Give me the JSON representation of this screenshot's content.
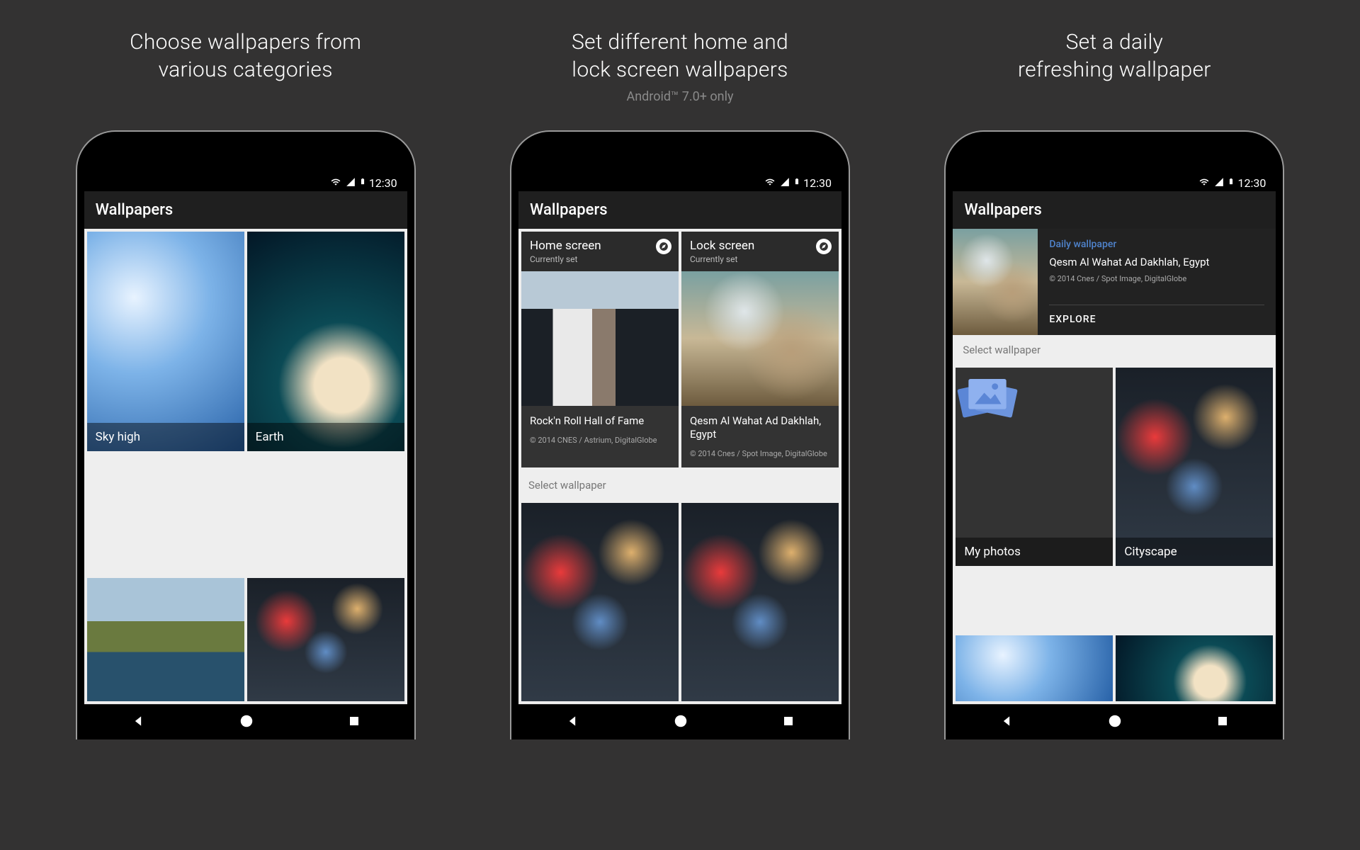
{
  "status_time": "12:30",
  "app_title": "Wallpapers",
  "select_wallpaper": "Select wallpaper",
  "panels": [
    {
      "headline": "Choose wallpapers from\nvarious categories",
      "subhead": "",
      "categories": [
        {
          "label": "Sky high"
        },
        {
          "label": "Earth"
        },
        {
          "label": ""
        },
        {
          "label": ""
        }
      ]
    },
    {
      "headline": "Set different home and\nlock screen wallpapers",
      "subhead": "Android™ 7.0+ only",
      "cards": [
        {
          "title": "Home screen",
          "sub": "Currently set",
          "name": "Rock'n Roll Hall of Fame",
          "attribution": "© 2014 CNES / Astrium, DigitalGlobe"
        },
        {
          "title": "Lock screen",
          "sub": "Currently set",
          "name": "Qesm Al Wahat Ad Dakhlah, Egypt",
          "attribution": "© 2014 Cnes / Spot Image, DigitalGlobe"
        }
      ]
    },
    {
      "headline": "Set a daily\nrefreshing wallpaper",
      "subhead": "",
      "daily": {
        "tag": "Daily wallpaper",
        "name": "Qesm Al Wahat Ad Dakhlah, Egypt",
        "attribution": "© 2014 Cnes / Spot Image, DigitalGlobe",
        "explore": "EXPLORE"
      },
      "tiles": [
        {
          "label": "My photos"
        },
        {
          "label": "Cityscape"
        }
      ]
    }
  ]
}
